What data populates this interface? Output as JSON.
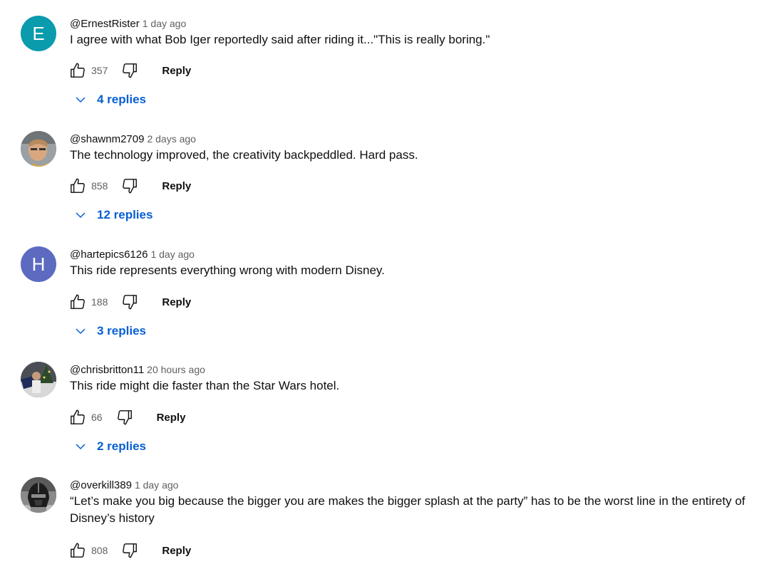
{
  "comments": [
    {
      "author": "@ErnestRister",
      "time": "1 day ago",
      "text": "I agree with what Bob Iger reportedly said after riding it...\"This is really boring.\"",
      "likes": "357",
      "reply_label": "Reply",
      "replies_label": "4 replies",
      "avatar_letter": "E",
      "avatar_color": "#0a9bad"
    },
    {
      "author": "@shawnm2709",
      "time": "2 days ago",
      "text": "The technology improved,  the creativity backpeddled. Hard pass.",
      "likes": "858",
      "reply_label": "Reply",
      "replies_label": "12 replies",
      "avatar_image": "photo-avatar-face"
    },
    {
      "author": "@hartepics6126",
      "time": "1 day ago",
      "text": "This ride represents everything wrong with modern Disney.",
      "likes": "188",
      "reply_label": "Reply",
      "replies_label": "3 replies",
      "avatar_letter": "H",
      "avatar_color": "#5c6bc0"
    },
    {
      "author": "@chrisbritton11",
      "time": "20 hours ago",
      "text": "This ride might die faster than the Star Wars hotel.",
      "likes": "66",
      "reply_label": "Reply",
      "replies_label": "2 replies",
      "avatar_image": "photo-avatar-group"
    },
    {
      "author": "@overkill389",
      "time": "1 day ago",
      "text": "“Let’s make you big because the bigger you are makes the bigger splash at the party” has to be the worst line in the entirety of Disney’s history",
      "likes": "808",
      "reply_label": "Reply",
      "avatar_image": "photo-avatar-helmet"
    }
  ],
  "icons": {
    "like": "thumbs-up-icon",
    "dislike": "thumbs-down-icon",
    "expand": "chevron-down-icon"
  },
  "colors": {
    "link_blue": "#065fd4",
    "secondary_text": "#606060"
  }
}
